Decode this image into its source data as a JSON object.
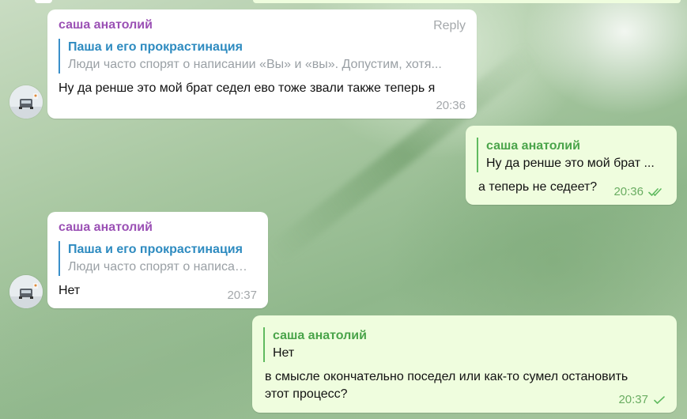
{
  "colors": {
    "incoming_bubble": "#ffffff",
    "outgoing_bubble": "#effdde",
    "sender_name_incoming": "#9b51b5",
    "quote_title_blue": "#2e8bc0",
    "quote_title_green": "#4aa44a",
    "time_outgoing": "#6aad62"
  },
  "messages": [
    {
      "sender": "саша анатолий",
      "reply_label": "Reply",
      "quote_title": "Паша и его прокрастинация",
      "quote_text": "Люди часто спорят о написании «Вы» и «вы». Допустим, хотя...",
      "text": "Ну да ренше это мой брат седел ево тоже звали также теперь я",
      "time": "20:36"
    },
    {
      "quote_title": "саша анатолий",
      "quote_text": "Ну да ренше это мой брат ...",
      "text": "а теперь не седеет?",
      "time": "20:36",
      "status_icon": "double-check-icon"
    },
    {
      "sender": "саша анатолий",
      "quote_title": "Паша и его прокрастинация",
      "quote_text": "Люди часто спорят о написании «Вы» и «вы». Допустим, хотя...",
      "text": "Нет",
      "time": "20:37"
    },
    {
      "quote_title": "саша анатолий",
      "quote_text": "Нет",
      "text_line1": "в смысле окончательно поседел или как-то сумел остановить",
      "text_line2": "этот процесс?",
      "time": "20:37",
      "status_icon": "single-check-icon"
    }
  ]
}
